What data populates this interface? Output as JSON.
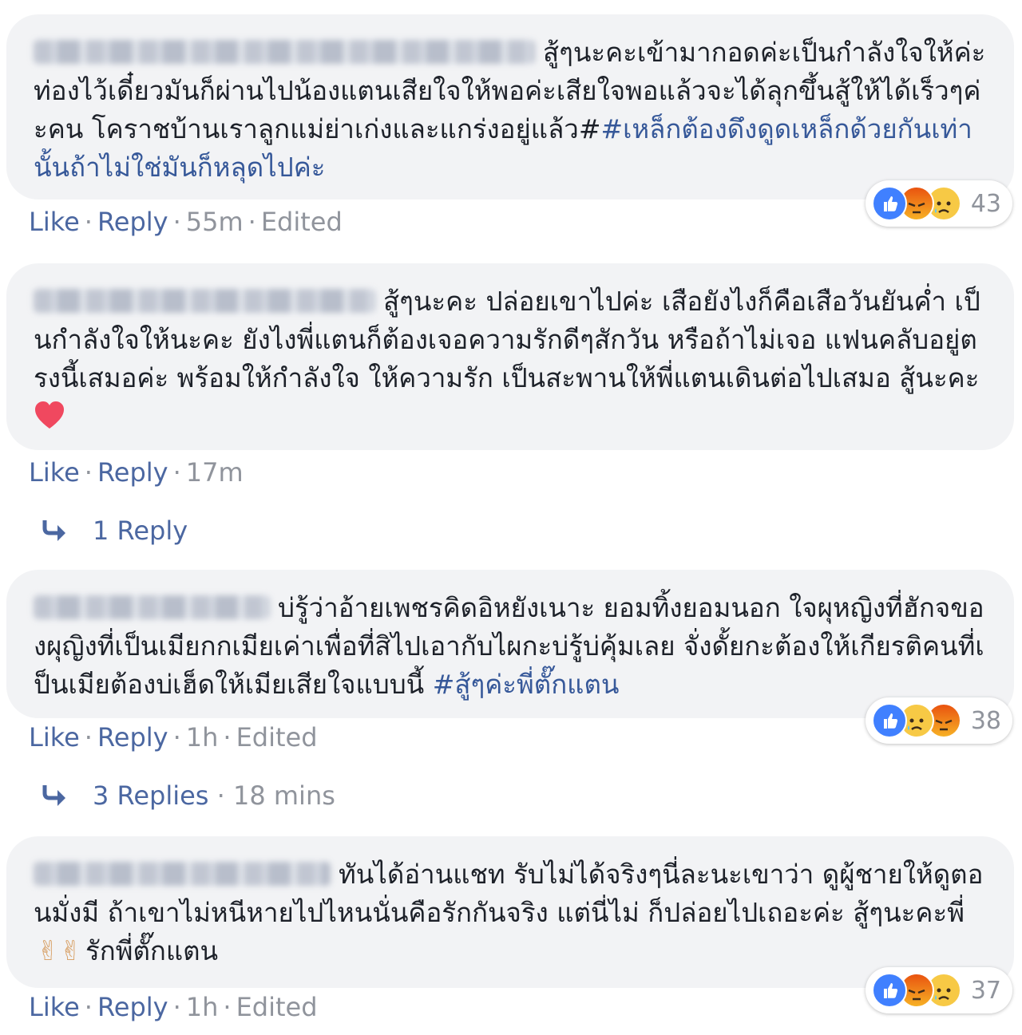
{
  "comments": [
    {
      "text_lines": "สู้ๆนะคะเข้ามากอดค่ะเป็นกำลังใจให้ค่ะท่องไว้เดี๋ยวมันก็ผ่านไปน้องแตนเสียใจให้พอค่ะเสียใจพอแล้วจะได้ลุกขึ้นสู้ให้ได้เร็วๆค่ะคน โคราชบ้านเราลูกแม่ย่าเก่งและแกร่งอยู่แล้ว#",
      "hashtag": "#เหล็กต้องดึงดูดเหล็กด้วยกันเท่านั้นถ้าไม่ใช่มันก็หลุดไปค่ะ",
      "like": "Like",
      "reply": "Reply",
      "time": "55m",
      "edited": "Edited",
      "reaction_count": "43"
    },
    {
      "text_lines": "สู้ๆนะคะ ปล่อยเขาไปค่ะ เสือยังไงก็คือเสือวันยันค่ำ เป็นกำลังใจให้นะคะ ยังไงพี่แตนก็ต้องเจอความรักดีๆสักวัน หรือถ้าไม่เจอ แฟนคลับอยู่ตรงนี้เสมอค่ะ พร้อมให้กำลังใจ ให้ความรัก เป็นสะพานให้พี่แตนเดินต่อไปเสมอ สู้นะคะ",
      "like": "Like",
      "reply": "Reply",
      "time": "17m",
      "replies_label": "1 Reply"
    },
    {
      "text_lines": "บ่รู้ว่าอ้ายเพชรคิดอิหยังเนาะ ยอมทิ้งยอมนอก ใจผุหญิงที่ฮักจของผุญิงที่เป็นเมียกกเมียเค่าเพื่อที่สิไปเอากับไผกะบ่รู้บ่คุ้มเลย จั่งดั้ยกะต้องให้เกียรติคนที่เป็นเมียต้องบ่เฮ็ดให้เมียเสียใจแบบนี้ ",
      "hashtag": "#สู้ๆค่ะพี่ตั๊กแตน",
      "like": "Like",
      "reply": "Reply",
      "time": "1h",
      "edited": "Edited",
      "reaction_count": "38",
      "replies_label": "3 Replies",
      "replies_time": "18 mins"
    },
    {
      "text_lines": "ทันได้อ่านแชท รับไม่ได้จริงๆนี่ละนะเขาว่า ดูผู้ชายให้ดูตอนมั่งมี ถ้าเขาไม่หนีหายไปไหนนั่นคือรักกันจริง แต่นี่ไม่ ก็ปล่อยไปเถอะค่ะ สู้ๆนะคะพี่",
      "text_after": "รักพี่ตั๊กแตน",
      "emoji_peace": "✌✌",
      "like": "Like",
      "reply": "Reply",
      "time": "1h",
      "edited": "Edited",
      "reaction_count": "37"
    }
  ],
  "colors": {
    "bubble": "#f2f3f5",
    "link": "#4b67a1",
    "hashtag": "#365899",
    "meta": "#90949c",
    "like_reaction": "#4080ff"
  },
  "icons": [
    "like-reaction-icon",
    "angry-reaction-icon",
    "sad-reaction-icon",
    "reply-arrow-icon",
    "heart-emoji-icon",
    "peace-emoji-icon"
  ]
}
